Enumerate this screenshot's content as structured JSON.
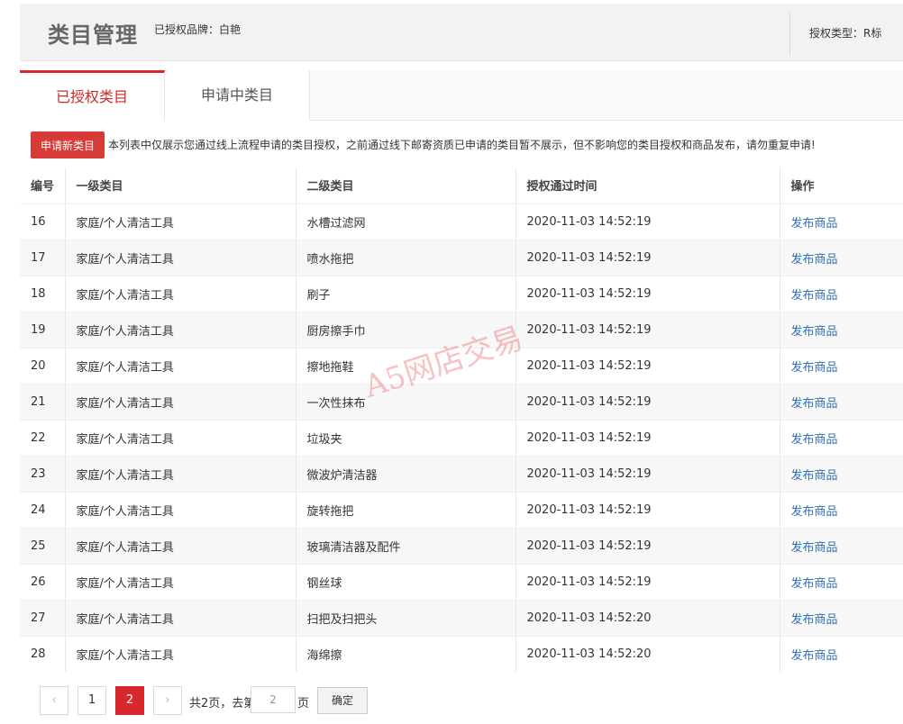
{
  "header": {
    "title": "类目管理",
    "brand": "已授权品牌：白艳",
    "auth_type": "授权类型：R标"
  },
  "tabs": [
    {
      "label": "已授权类目",
      "active": true
    },
    {
      "label": "申请中类目",
      "active": false
    }
  ],
  "notice": {
    "button_label": "申请新类目",
    "text": "本列表中仅展示您通过线上流程申请的类目授权，之前通过线下邮寄资质已申请的类目暂不展示，但不影响您的类目授权和商品发布，请勿重复申请!"
  },
  "table": {
    "headers": [
      "编号",
      "一级类目",
      "二级类目",
      "授权通过时间",
      "操作"
    ],
    "rows": [
      {
        "id": "16",
        "cat1": "家庭/个人清洁工具",
        "cat2": "水槽过滤网",
        "time": "2020-11-03 14:52:19",
        "action": "发布商品"
      },
      {
        "id": "17",
        "cat1": "家庭/个人清洁工具",
        "cat2": "喷水拖把",
        "time": "2020-11-03 14:52:19",
        "action": "发布商品"
      },
      {
        "id": "18",
        "cat1": "家庭/个人清洁工具",
        "cat2": "刷子",
        "time": "2020-11-03 14:52:19",
        "action": "发布商品"
      },
      {
        "id": "19",
        "cat1": "家庭/个人清洁工具",
        "cat2": "厨房擦手巾",
        "time": "2020-11-03 14:52:19",
        "action": "发布商品"
      },
      {
        "id": "20",
        "cat1": "家庭/个人清洁工具",
        "cat2": "擦地拖鞋",
        "time": "2020-11-03 14:52:19",
        "action": "发布商品"
      },
      {
        "id": "21",
        "cat1": "家庭/个人清洁工具",
        "cat2": "一次性抹布",
        "time": "2020-11-03 14:52:19",
        "action": "发布商品"
      },
      {
        "id": "22",
        "cat1": "家庭/个人清洁工具",
        "cat2": "垃圾夹",
        "time": "2020-11-03 14:52:19",
        "action": "发布商品"
      },
      {
        "id": "23",
        "cat1": "家庭/个人清洁工具",
        "cat2": "微波炉清洁器",
        "time": "2020-11-03 14:52:19",
        "action": "发布商品"
      },
      {
        "id": "24",
        "cat1": "家庭/个人清洁工具",
        "cat2": "旋转拖把",
        "time": "2020-11-03 14:52:19",
        "action": "发布商品"
      },
      {
        "id": "25",
        "cat1": "家庭/个人清洁工具",
        "cat2": "玻璃清洁器及配件",
        "time": "2020-11-03 14:52:19",
        "action": "发布商品"
      },
      {
        "id": "26",
        "cat1": "家庭/个人清洁工具",
        "cat2": "钢丝球",
        "time": "2020-11-03 14:52:19",
        "action": "发布商品"
      },
      {
        "id": "27",
        "cat1": "家庭/个人清洁工具",
        "cat2": "扫把及扫把头",
        "time": "2020-11-03 14:52:20",
        "action": "发布商品"
      },
      {
        "id": "28",
        "cat1": "家庭/个人清洁工具",
        "cat2": "海绵擦",
        "time": "2020-11-03 14:52:20",
        "action": "发布商品"
      }
    ]
  },
  "watermark": "A5网店交易",
  "pagination": {
    "prev": "‹",
    "pages": [
      "1",
      "2"
    ],
    "current": "2",
    "next": "›",
    "total_text": "共2页，去第",
    "input_value": "2",
    "page_suffix": "页",
    "confirm_label": "确定"
  }
}
